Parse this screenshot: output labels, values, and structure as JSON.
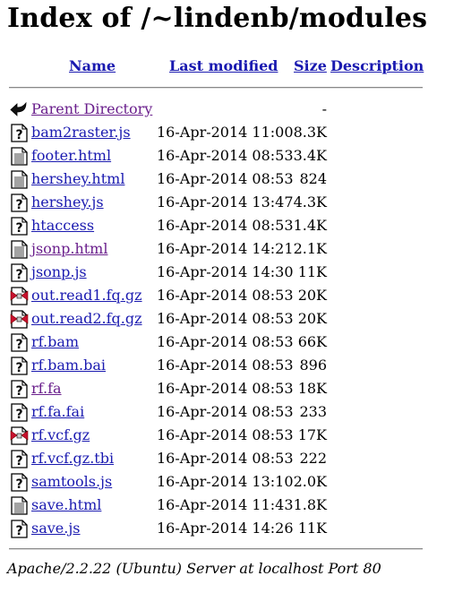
{
  "page": {
    "title": "Index of /~lindenb/modules"
  },
  "columns": {
    "name": "Name",
    "last_modified": "Last modified",
    "size": "Size",
    "description": "Description"
  },
  "rows": [
    {
      "name": "Parent Directory",
      "date": "",
      "size": "-",
      "icon": "back-icon",
      "visited": true
    },
    {
      "name": "bam2raster.js",
      "date": "16-Apr-2014 11:00",
      "size": "8.3K",
      "icon": "unknown-file-icon"
    },
    {
      "name": "footer.html",
      "date": "16-Apr-2014 08:53",
      "size": "3.4K",
      "icon": "text-file-icon"
    },
    {
      "name": "hershey.html",
      "date": "16-Apr-2014 08:53",
      "size": "824",
      "icon": "text-file-icon"
    },
    {
      "name": "hershey.js",
      "date": "16-Apr-2014 13:47",
      "size": "4.3K",
      "icon": "unknown-file-icon"
    },
    {
      "name": "htaccess",
      "date": "16-Apr-2014 08:53",
      "size": "1.4K",
      "icon": "unknown-file-icon"
    },
    {
      "name": "jsonp.html",
      "date": "16-Apr-2014 14:21",
      "size": "2.1K",
      "icon": "text-file-icon",
      "visited": true
    },
    {
      "name": "jsonp.js",
      "date": "16-Apr-2014 14:30",
      "size": "11K",
      "icon": "unknown-file-icon"
    },
    {
      "name": "out.read1.fq.gz",
      "date": "16-Apr-2014 08:53",
      "size": "20K",
      "icon": "compressed-file-icon"
    },
    {
      "name": "out.read2.fq.gz",
      "date": "16-Apr-2014 08:53",
      "size": "20K",
      "icon": "compressed-file-icon"
    },
    {
      "name": "rf.bam",
      "date": "16-Apr-2014 08:53",
      "size": "66K",
      "icon": "unknown-file-icon"
    },
    {
      "name": "rf.bam.bai",
      "date": "16-Apr-2014 08:53",
      "size": "896",
      "icon": "unknown-file-icon"
    },
    {
      "name": "rf.fa",
      "date": "16-Apr-2014 08:53",
      "size": "18K",
      "icon": "unknown-file-icon",
      "visited": true
    },
    {
      "name": "rf.fa.fai",
      "date": "16-Apr-2014 08:53",
      "size": "233",
      "icon": "unknown-file-icon"
    },
    {
      "name": "rf.vcf.gz",
      "date": "16-Apr-2014 08:53",
      "size": "17K",
      "icon": "compressed-file-icon"
    },
    {
      "name": "rf.vcf.gz.tbi",
      "date": "16-Apr-2014 08:53",
      "size": "222",
      "icon": "unknown-file-icon"
    },
    {
      "name": "samtools.js",
      "date": "16-Apr-2014 13:10",
      "size": "2.0K",
      "icon": "unknown-file-icon"
    },
    {
      "name": "save.html",
      "date": "16-Apr-2014 11:43",
      "size": "1.8K",
      "icon": "text-file-icon"
    },
    {
      "name": "save.js",
      "date": "16-Apr-2014 14:26",
      "size": "11K",
      "icon": "unknown-file-icon"
    }
  ],
  "footer": {
    "address": "Apache/2.2.22 (Ubuntu) Server at localhost Port 80"
  },
  "colors": {
    "link": "#1a1ab0",
    "visited_link": "#6a1f8c"
  }
}
